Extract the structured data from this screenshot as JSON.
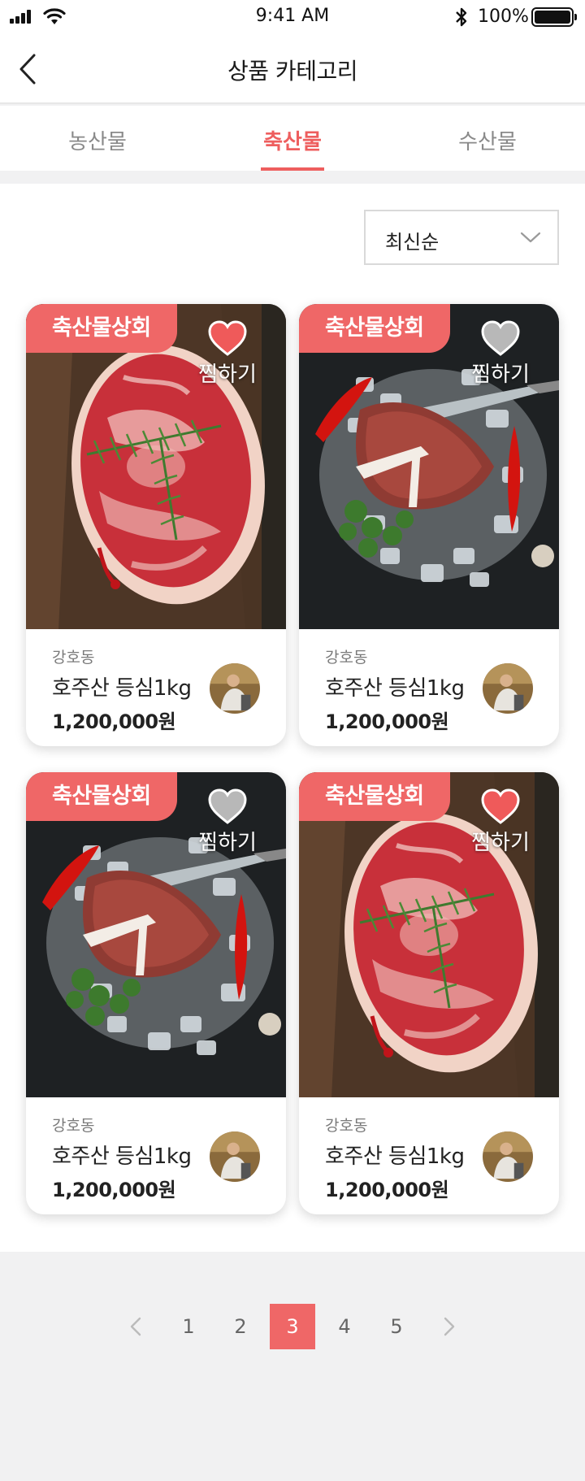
{
  "status_bar": {
    "time": "9:41 AM",
    "battery": "100%"
  },
  "header": {
    "title": "상품 카테고리",
    "back_icon": "chevron-left-icon"
  },
  "tabs": [
    {
      "label": "농산물",
      "active": false
    },
    {
      "label": "축산물",
      "active": true
    },
    {
      "label": "수산물",
      "active": false
    }
  ],
  "sort": {
    "selected": "최신순"
  },
  "colors": {
    "accent": "#ef6767",
    "tab_active": "#ee5e5e"
  },
  "products": [
    {
      "badge": "축산물상회",
      "wish_label": "찜하기",
      "wished": true,
      "image": "ribeye-steak",
      "seller": "강호동",
      "name": "호주산 등심1kg",
      "price": "1,200,000원"
    },
    {
      "badge": "축산물상회",
      "wish_label": "찜하기",
      "wished": false,
      "image": "tbone-steak",
      "seller": "강호동",
      "name": "호주산 등심1kg",
      "price": "1,200,000원"
    },
    {
      "badge": "축산물상회",
      "wish_label": "찜하기",
      "wished": false,
      "image": "tbone-steak",
      "seller": "강호동",
      "name": "호주산 등심1kg",
      "price": "1,200,000원"
    },
    {
      "badge": "축산물상회",
      "wish_label": "찜하기",
      "wished": true,
      "image": "ribeye-steak",
      "seller": "강호동",
      "name": "호주산 등심1kg",
      "price": "1,200,000원"
    }
  ],
  "pagination": {
    "pages": [
      "1",
      "2",
      "3",
      "4",
      "5"
    ],
    "current": "3"
  }
}
